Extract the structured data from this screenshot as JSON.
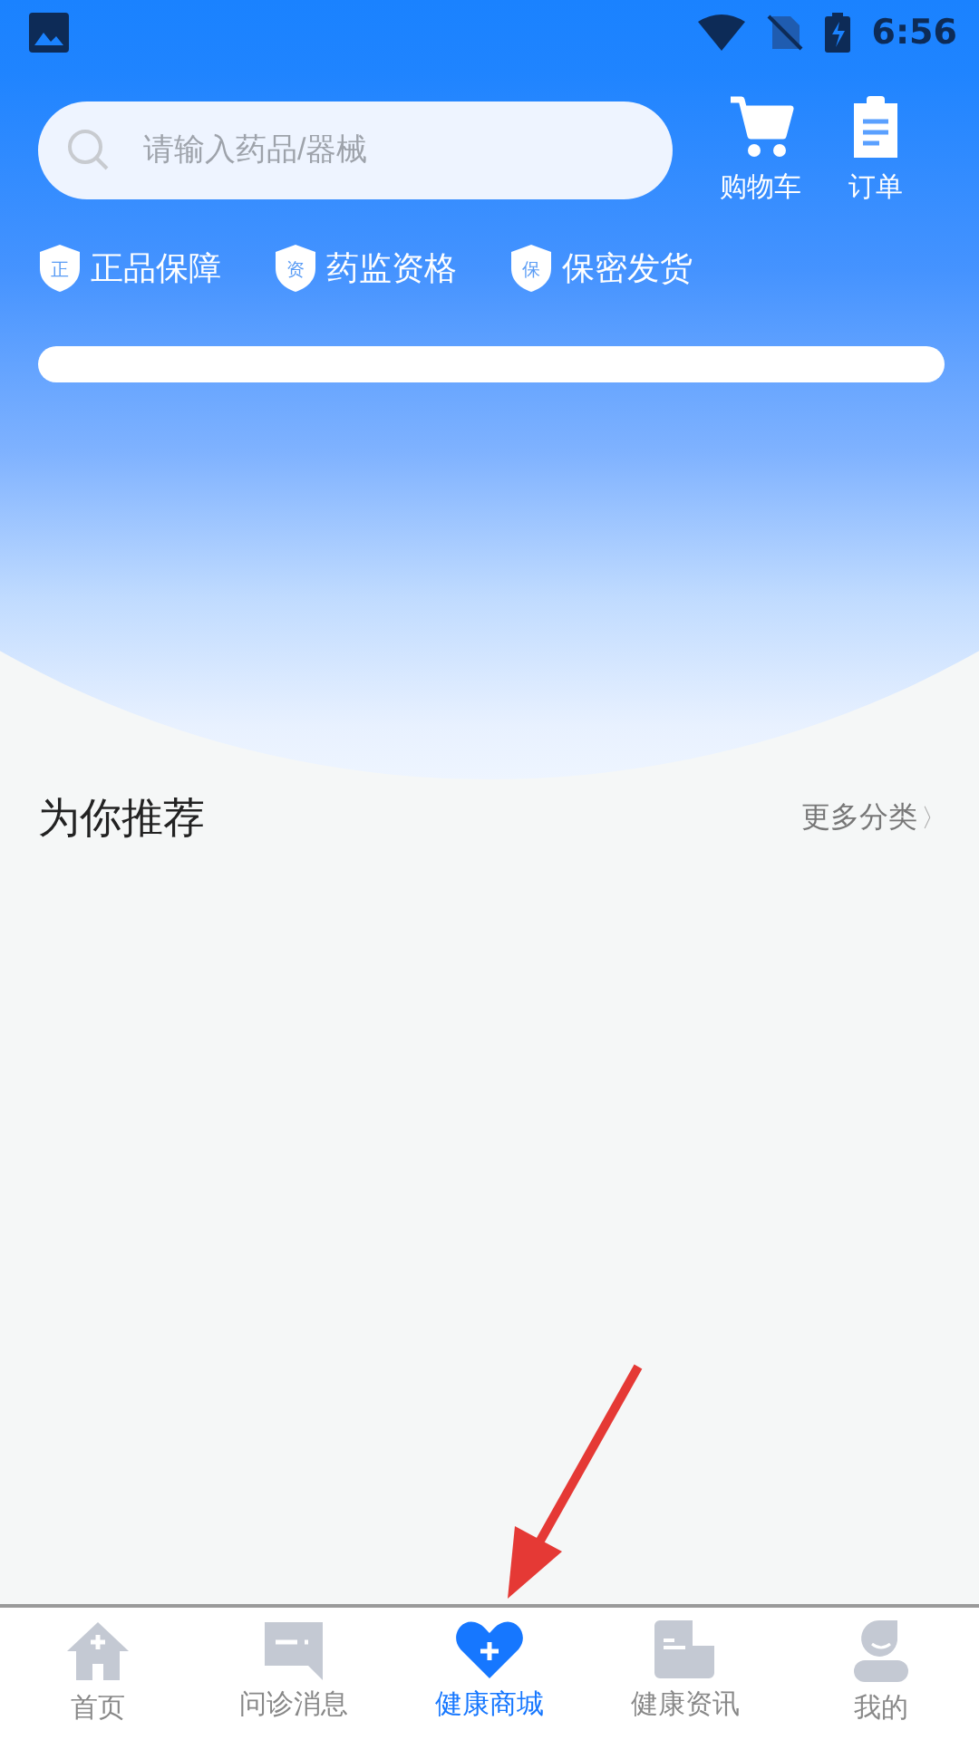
{
  "status_bar": {
    "time": "6:56"
  },
  "search": {
    "placeholder": "请输入药品/器械"
  },
  "header_actions": [
    {
      "kind": "cart",
      "label": "购物车"
    },
    {
      "kind": "orders",
      "label": "订单"
    }
  ],
  "badges": [
    {
      "mark": "正",
      "label": "正品保障"
    },
    {
      "mark": "资",
      "label": "药监资格"
    },
    {
      "mark": "保",
      "label": "保密发货"
    }
  ],
  "section": {
    "title": "为你推荐",
    "more": "更多分类",
    "more_icon": "〉"
  },
  "tabs": [
    {
      "kind": "home",
      "label": "首页",
      "selected": false
    },
    {
      "kind": "chat",
      "label": "问诊消息",
      "selected": false
    },
    {
      "kind": "heart",
      "label": "健康商城",
      "selected": true
    },
    {
      "kind": "news",
      "label": "健康资讯",
      "selected": false
    },
    {
      "kind": "user",
      "label": "我的",
      "selected": false
    }
  ]
}
